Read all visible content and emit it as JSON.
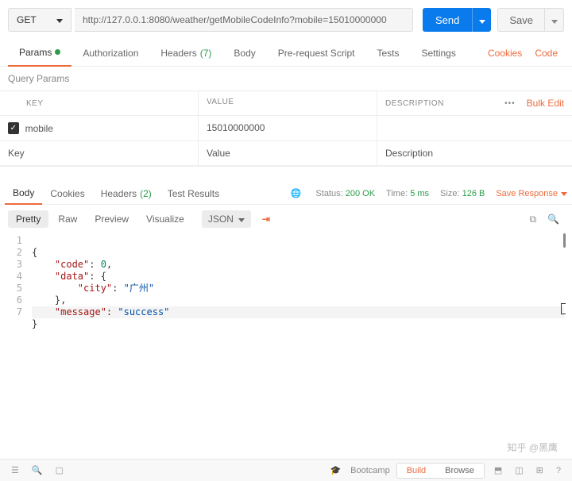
{
  "request": {
    "method": "GET",
    "url": "http://127.0.0.1:8080/weather/getMobileCodeInfo?mobile=15010000000",
    "send_label": "Send",
    "save_label": "Save"
  },
  "tabs": {
    "params": "Params",
    "authorization": "Authorization",
    "headers": "Headers",
    "headers_count": "(7)",
    "body": "Body",
    "prerequest": "Pre-request Script",
    "tests": "Tests",
    "settings": "Settings",
    "cookies": "Cookies",
    "code": "Code"
  },
  "params": {
    "section_title": "Query Params",
    "header_key": "KEY",
    "header_value": "VALUE",
    "header_desc": "DESCRIPTION",
    "bulk_edit": "Bulk Edit",
    "row_key": "mobile",
    "row_value": "15010000000",
    "ph_key": "Key",
    "ph_value": "Value",
    "ph_desc": "Description"
  },
  "response": {
    "tabs": {
      "body": "Body",
      "cookies": "Cookies",
      "headers": "Headers",
      "headers_count": "(2)",
      "tests": "Test Results"
    },
    "status_label": "Status:",
    "status_value": "200 OK",
    "time_label": "Time:",
    "time_value": "5 ms",
    "size_label": "Size:",
    "size_value": "126 B",
    "save_response": "Save Response"
  },
  "viewer": {
    "pretty": "Pretty",
    "raw": "Raw",
    "preview": "Preview",
    "visualize": "Visualize",
    "lang": "JSON"
  },
  "code_lines": {
    "l1": "{",
    "l2a": "    \"code\"",
    "l2b": ": ",
    "l2c": "0",
    "l2d": ",",
    "l3a": "    \"data\"",
    "l3b": ": {",
    "l4a": "        \"city\"",
    "l4b": ": ",
    "l4c": "\"广州\"",
    "l5": "    },",
    "l6a": "    \"message\"",
    "l6b": ": ",
    "l6c": "\"success\"",
    "l7": "}"
  },
  "gutter": {
    "n1": "1",
    "n2": "2",
    "n3": "3",
    "n4": "4",
    "n5": "5",
    "n6": "6",
    "n7": "7"
  },
  "bottom": {
    "bootcamp": "Bootcamp",
    "build": "Build",
    "browse": "Browse"
  },
  "watermark": "知乎 @黑鹰"
}
